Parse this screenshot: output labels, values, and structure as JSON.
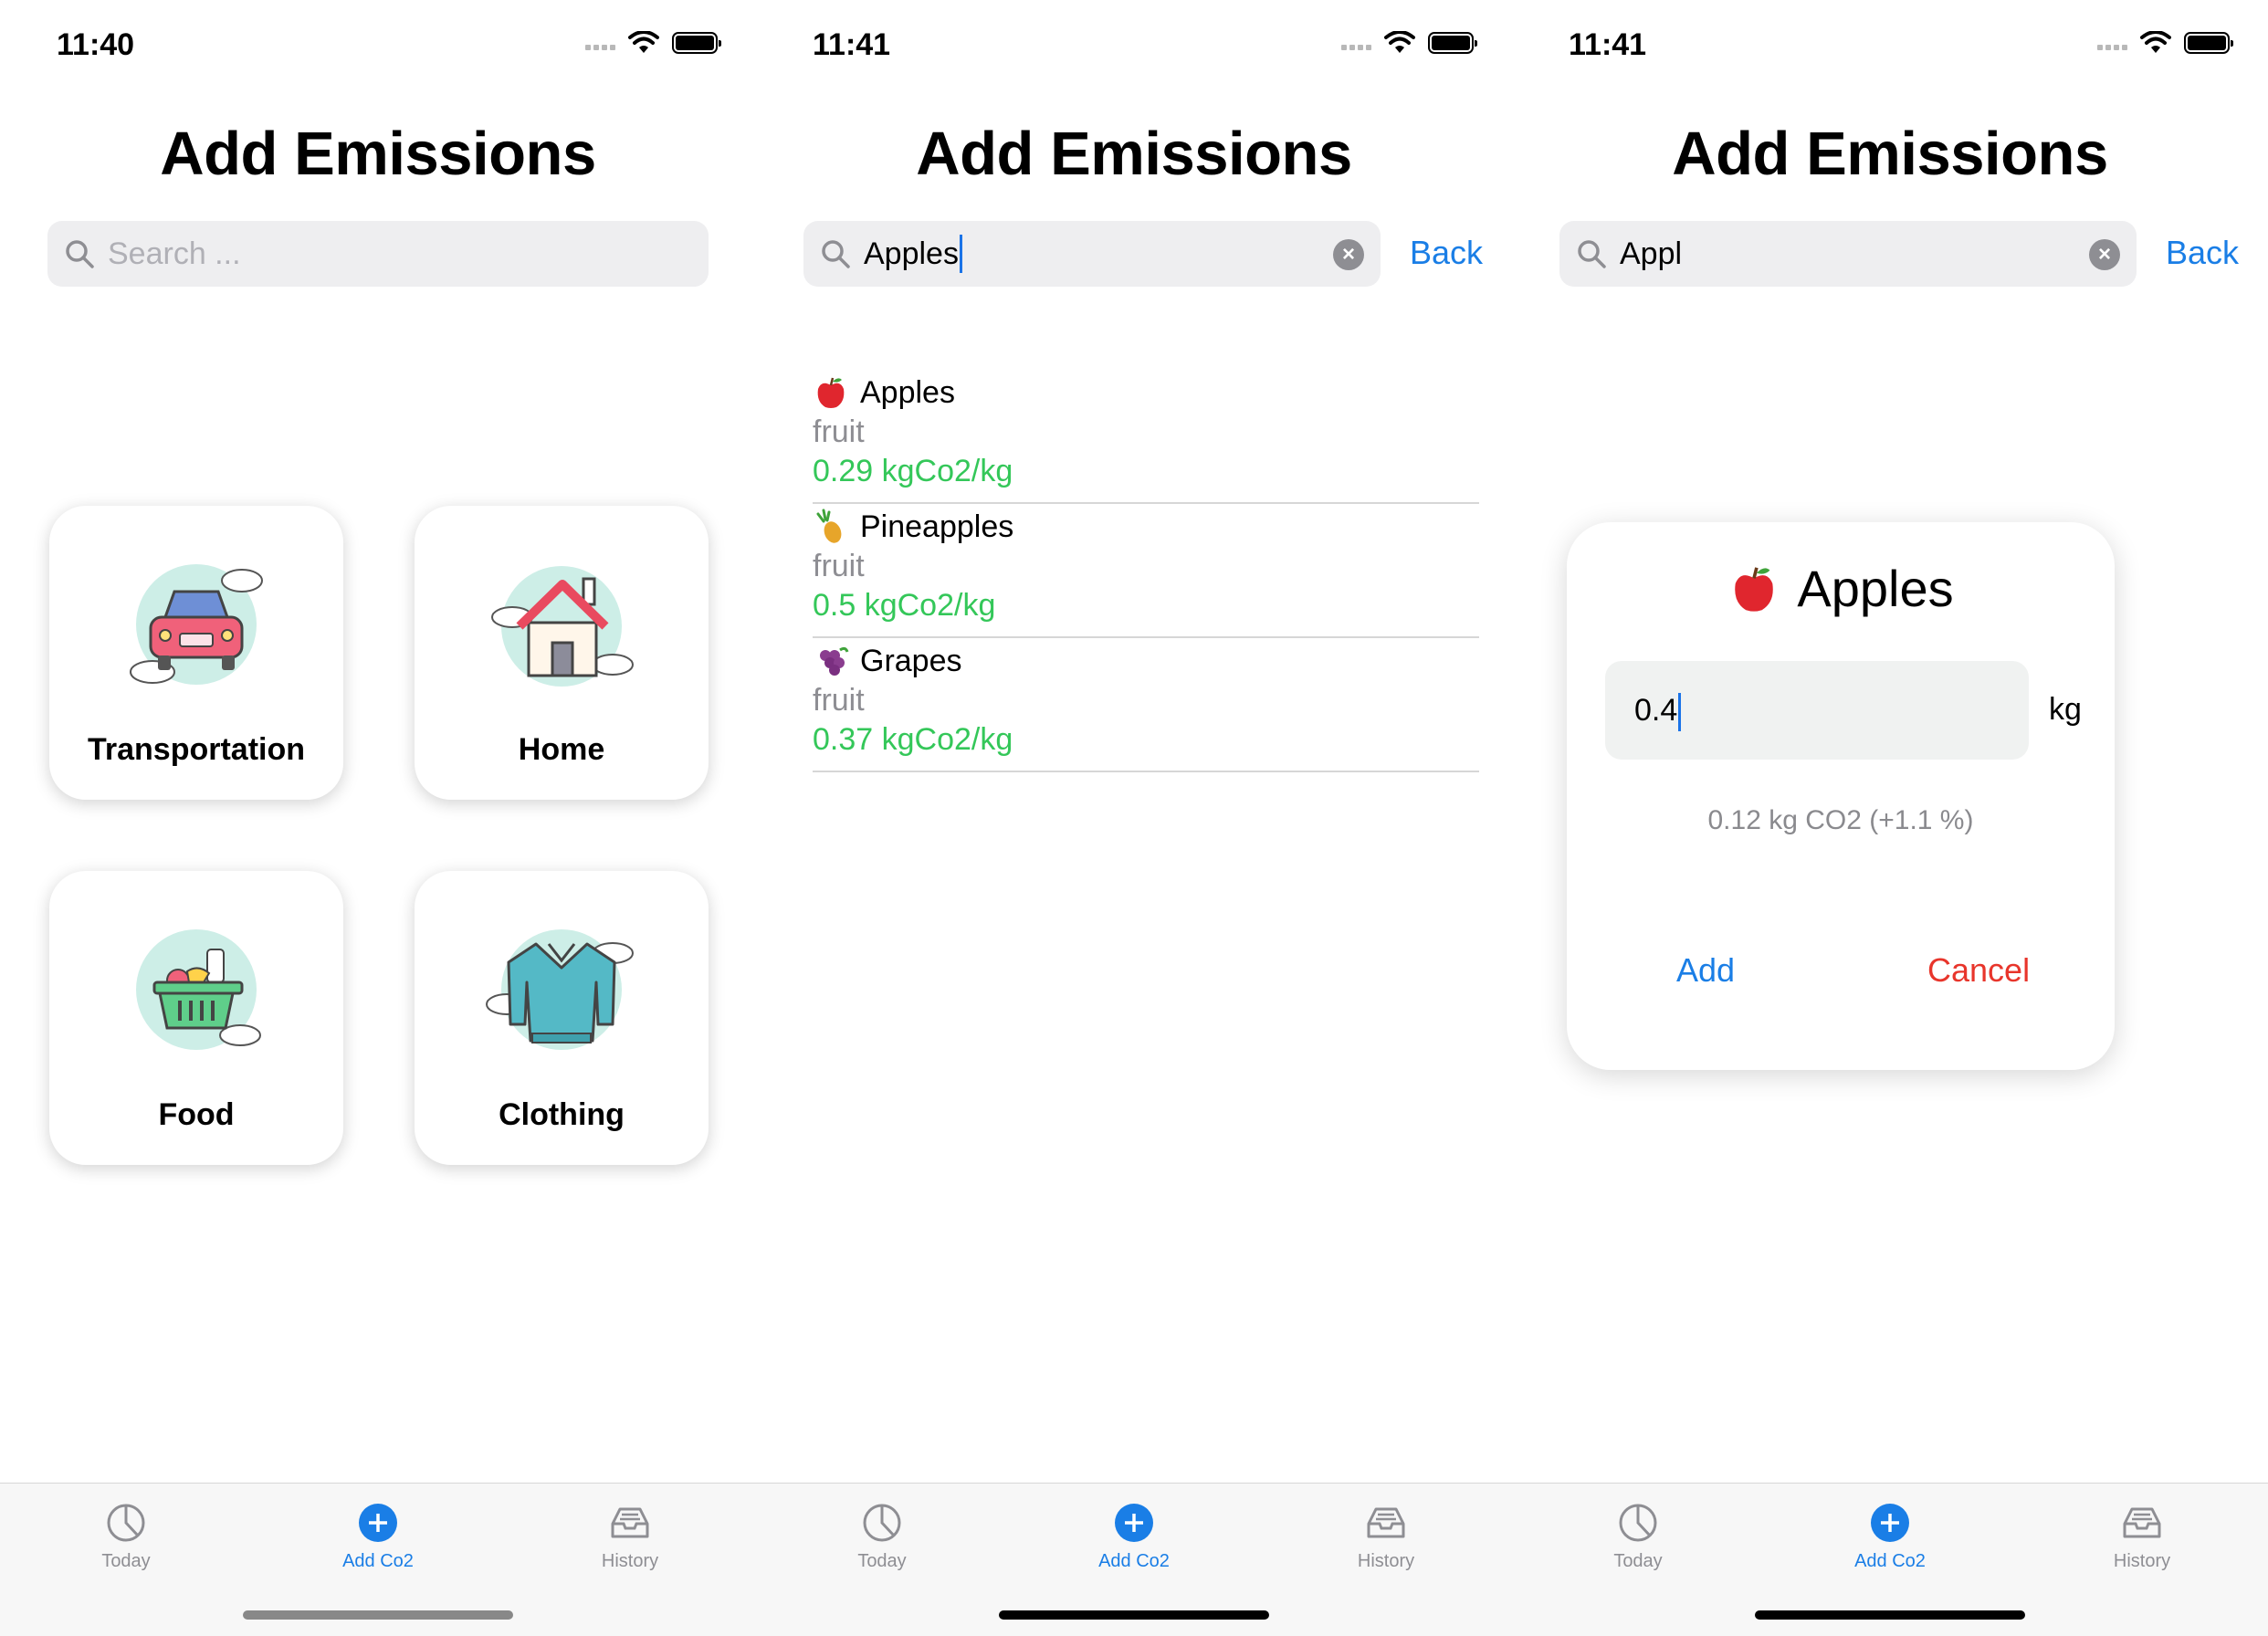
{
  "screens": [
    {
      "time": "11:40",
      "title": "Add Emissions",
      "search": {
        "placeholder": "Search ..."
      },
      "categories": [
        {
          "label": "Transportation",
          "icon": "car-icon"
        },
        {
          "label": "Home",
          "icon": "house-icon"
        },
        {
          "label": "Food",
          "icon": "basket-icon"
        },
        {
          "label": "Clothing",
          "icon": "sweater-icon"
        }
      ]
    },
    {
      "time": "11:41",
      "title": "Add Emissions",
      "search": {
        "value": "Apples"
      },
      "back_label": "Back",
      "results": [
        {
          "name": "Apples",
          "category": "fruit",
          "value": "0.29 kgCo2/kg",
          "icon": "apple-icon"
        },
        {
          "name": "Pineapples",
          "category": "fruit",
          "value": "0.5 kgCo2/kg",
          "icon": "pineapple-icon"
        },
        {
          "name": "Grapes",
          "category": "fruit",
          "value": "0.37 kgCo2/kg",
          "icon": "grapes-icon"
        }
      ]
    },
    {
      "time": "11:41",
      "title": "Add Emissions",
      "search": {
        "value": "Appl"
      },
      "back_label": "Back",
      "dialog": {
        "title": "Apples",
        "icon": "apple-icon",
        "amount": "0.4",
        "unit": "kg",
        "info": "0.12 kg CO2 (+1.1 %)",
        "add_label": "Add",
        "cancel_label": "Cancel"
      }
    }
  ],
  "tabs": [
    {
      "label": "Today",
      "icon": "pie-chart-icon"
    },
    {
      "label": "Add Co2",
      "icon": "plus-circle-icon",
      "active": true
    },
    {
      "label": "History",
      "icon": "tray-icon"
    }
  ],
  "colors": {
    "accent": "#1a7ee6",
    "green": "#34c759",
    "red": "#e8352b"
  }
}
